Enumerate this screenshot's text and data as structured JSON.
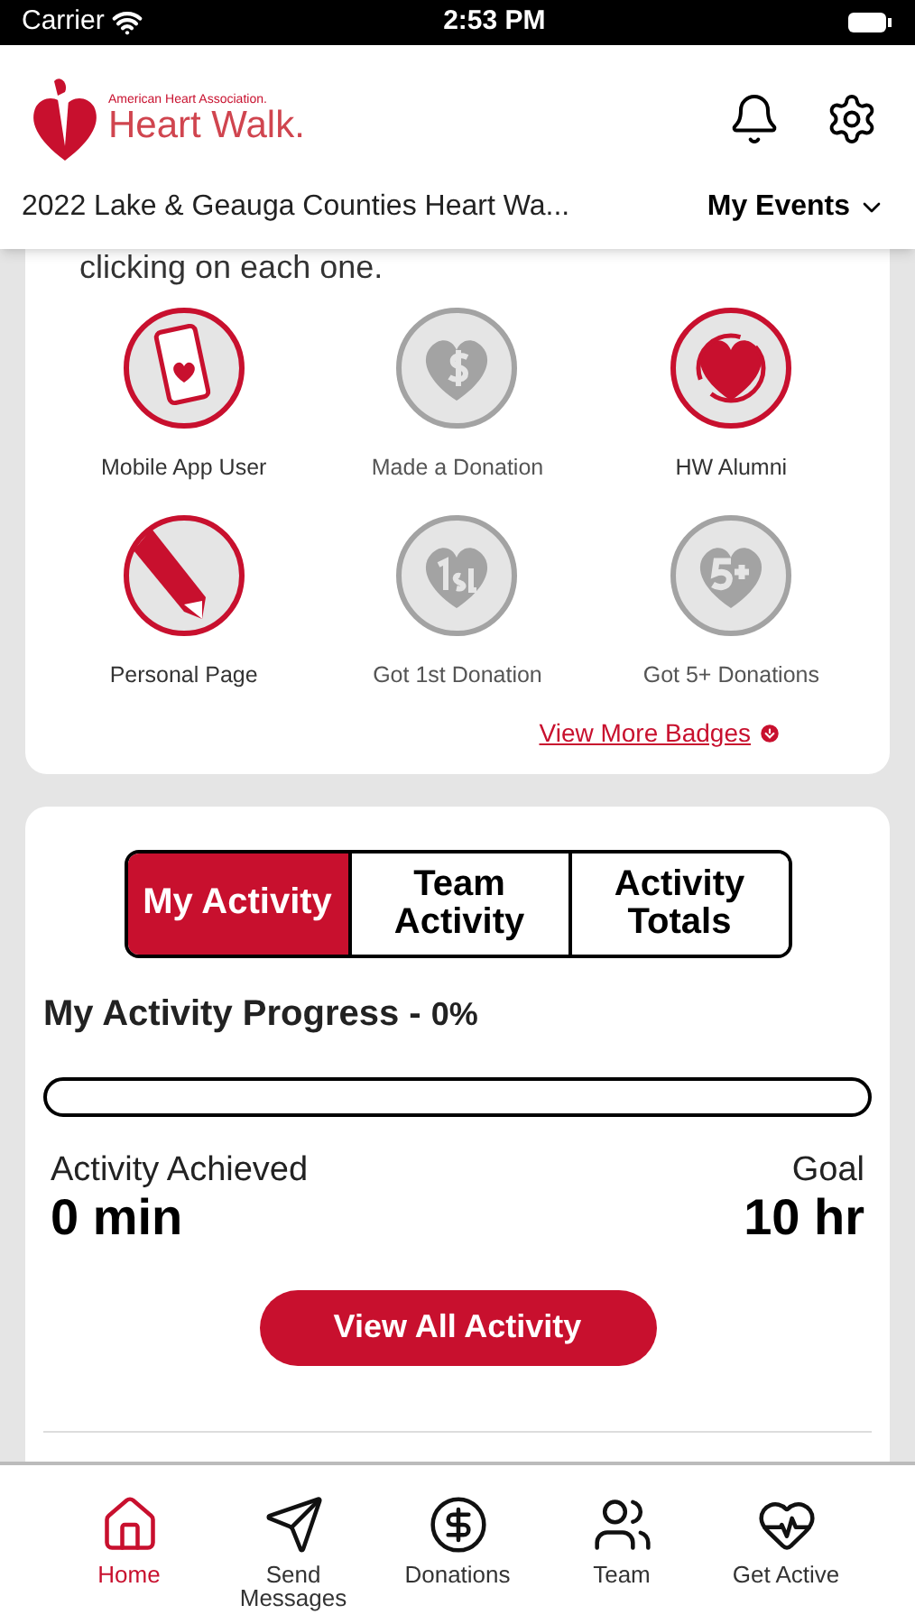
{
  "status_bar": {
    "carrier": "Carrier",
    "time": "2:53 PM"
  },
  "header": {
    "logo_small": "American Heart Association.",
    "logo_large": "Heart Walk.",
    "event": "2022 Lake & Geauga Counties Heart Wa...",
    "events_menu": "My Events"
  },
  "badges_card": {
    "intro": "clicking on each one.",
    "badges": [
      {
        "label": "Mobile App User",
        "kind": "phone",
        "earned": true
      },
      {
        "label": "Made a Donation",
        "kind": "dollar",
        "earned": false
      },
      {
        "label": "HW Alumni",
        "kind": "cycle",
        "earned": true
      },
      {
        "label": "Personal Page",
        "kind": "pencil",
        "earned": true
      },
      {
        "label": "Got 1st Donation",
        "kind": "first",
        "earned": false
      },
      {
        "label": "Got 5+ Donations",
        "kind": "five",
        "earned": false
      }
    ],
    "more_link": "View More Badges"
  },
  "activity_card": {
    "tabs": [
      {
        "label": "My Activity",
        "selected": true
      },
      {
        "label": "Team Activity",
        "selected": false
      },
      {
        "label": "Activity Totals",
        "selected": false
      }
    ],
    "progress_title": "My Activity Progress - ",
    "progress_value": "0%",
    "level": 0,
    "achieved_label": "Activity Achieved",
    "achieved_value": "0 min",
    "goal_label": "Goal",
    "goal_value": "10 hr",
    "button": "View All Activity"
  },
  "nav": [
    {
      "label": "Home",
      "selected": true
    },
    {
      "label": "Send Messages",
      "selected": false
    },
    {
      "label": "Donations",
      "selected": false
    },
    {
      "label": "Team",
      "selected": false
    },
    {
      "label": "Get Active",
      "selected": false
    }
  ]
}
